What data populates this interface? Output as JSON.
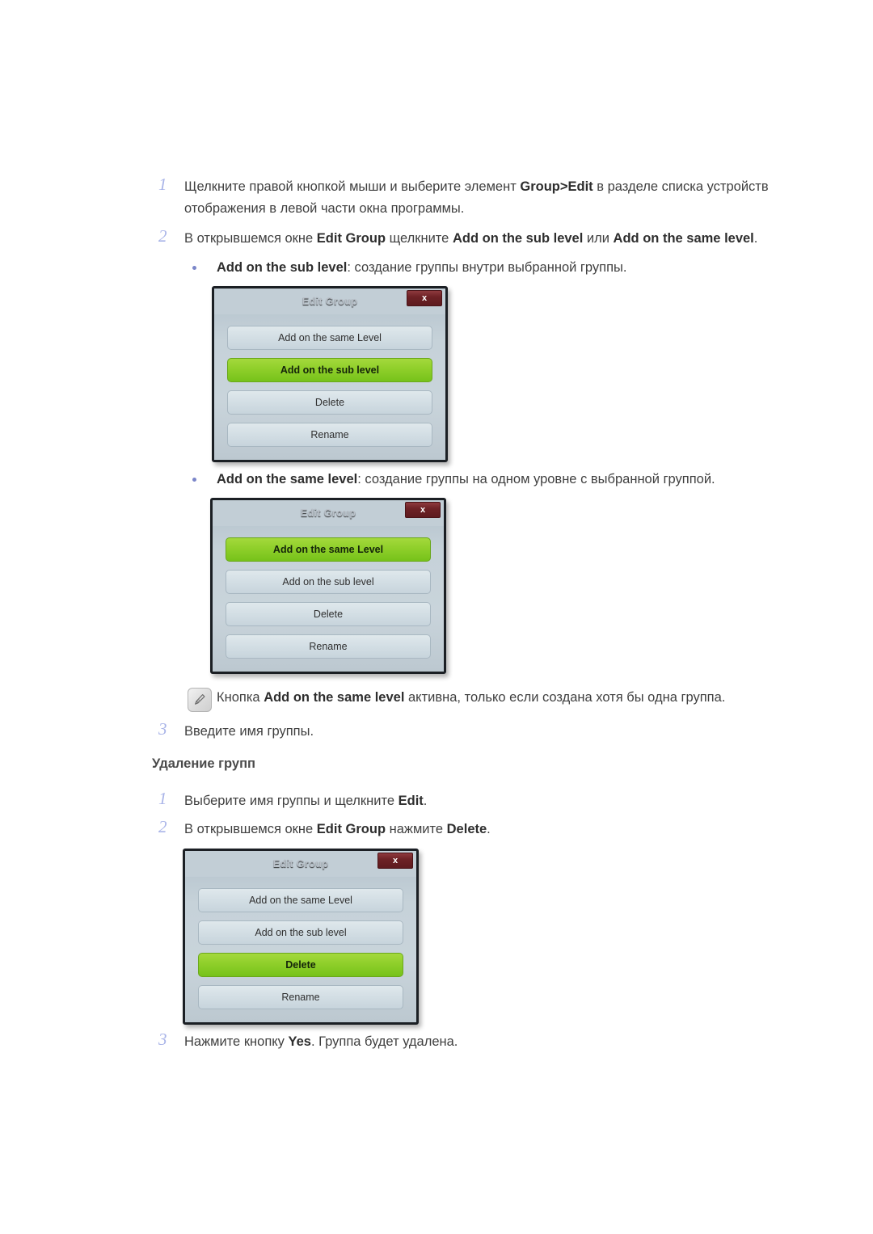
{
  "page": {
    "accent_step_number": "#a9b4e8",
    "accent_bullet": "#7b86c9",
    "active_button_green": "#8fcf2a",
    "close_button_red": "#6e2226",
    "titlebar_dark": "#2b323c"
  },
  "group_create": {
    "steps": [
      {
        "num": "1",
        "parts": [
          {
            "t": "Щелкните правой кнопкой мыши и выберите элемент ",
            "b": false
          },
          {
            "t": "Group>Edit",
            "b": true
          },
          {
            "t": " в разделе списка устройств отображения в левой части окна программы.",
            "b": false
          }
        ]
      },
      {
        "num": "2",
        "parts": [
          {
            "t": "В открывшемся окне ",
            "b": false
          },
          {
            "t": "Edit Group",
            "b": true
          },
          {
            "t": " щелкните ",
            "b": false
          },
          {
            "t": "Add on the sub level",
            "b": true
          },
          {
            "t": " или ",
            "b": false
          },
          {
            "t": "Add on the same level",
            "b": true
          },
          {
            "t": ".",
            "b": false
          }
        ]
      },
      {
        "num": "3",
        "parts": [
          {
            "t": "Введите имя группы.",
            "b": false
          }
        ]
      }
    ],
    "bullet_sub": [
      {
        "t": "Add on the sub level",
        "b": true
      },
      {
        "t": ": создание группы внутри выбранной группы.",
        "b": false
      }
    ],
    "bullet_same": [
      {
        "t": "Add on the same level",
        "b": true
      },
      {
        "t": ": создание группы на одном уровне с выбранной группой.",
        "b": false
      }
    ],
    "note": [
      {
        "t": "Кнопка ",
        "b": false
      },
      {
        "t": "Add on the same level",
        "b": true
      },
      {
        "t": " активна, только если создана хотя бы одна группа.",
        "b": false
      }
    ],
    "note_icon": "note-pencil-icon"
  },
  "group_delete": {
    "heading": "Удаление групп",
    "steps": [
      {
        "num": "1",
        "parts": [
          {
            "t": "Выберите имя группы и щелкните ",
            "b": false
          },
          {
            "t": "Edit",
            "b": true
          },
          {
            "t": ".",
            "b": false
          }
        ]
      },
      {
        "num": "2",
        "parts": [
          {
            "t": "В открывшемся окне ",
            "b": false
          },
          {
            "t": "Edit Group",
            "b": true
          },
          {
            "t": " нажмите ",
            "b": false
          },
          {
            "t": "Delete",
            "b": true
          },
          {
            "t": ".",
            "b": false
          }
        ]
      },
      {
        "num": "3",
        "parts": [
          {
            "t": "Нажмите кнопку ",
            "b": false
          },
          {
            "t": "Yes",
            "b": true
          },
          {
            "t": ". Группа будет удалена.",
            "b": false
          }
        ]
      }
    ]
  },
  "dialogs": [
    {
      "id": "dialog-sub-level",
      "title": "Edit Group",
      "close_label": "x",
      "buttons": [
        {
          "label": "Add on the same Level",
          "state": "normal"
        },
        {
          "label": "Add on the sub level",
          "state": "active"
        },
        {
          "label": "Delete",
          "state": "normal"
        },
        {
          "label": "Rename",
          "state": "normal"
        }
      ]
    },
    {
      "id": "dialog-same-level",
      "title": "Edit Group",
      "close_label": "x",
      "buttons": [
        {
          "label": "Add on the same Level",
          "state": "active"
        },
        {
          "label": "Add on the sub level",
          "state": "normal"
        },
        {
          "label": "Delete",
          "state": "normal"
        },
        {
          "label": "Rename",
          "state": "normal"
        }
      ]
    },
    {
      "id": "dialog-delete",
      "title": "Edit Group",
      "close_label": "x",
      "buttons": [
        {
          "label": "Add on the same Level",
          "state": "normal"
        },
        {
          "label": "Add on the sub level",
          "state": "normal"
        },
        {
          "label": "Delete",
          "state": "active"
        },
        {
          "label": "Rename",
          "state": "normal"
        }
      ]
    }
  ]
}
